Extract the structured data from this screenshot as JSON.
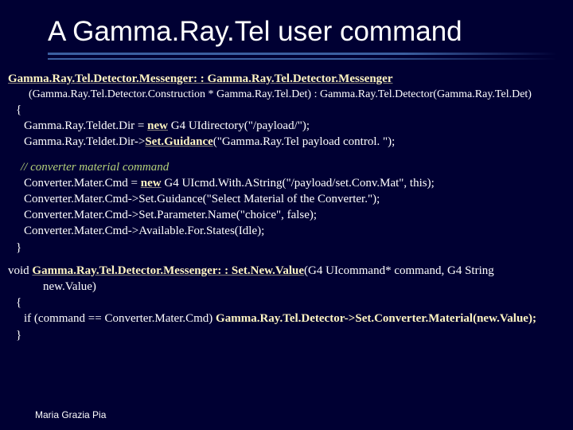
{
  "title": "A Gamma.Ray.Tel user command",
  "ctor_decl": "Gamma.Ray.Tel.Detector.Messenger: : Gamma.Ray.Tel.Detector.Messenger",
  "ctor_params": "(Gamma.Ray.Tel.Detector.Construction * Gamma.Ray.Tel.Det) : Gamma.Ray.Tel.Detector(Gamma.Ray.Tel.Det)",
  "open_brace": "{",
  "line_dir1_pre": "Gamma.Ray.Teldet.Dir = ",
  "line_dir1_bold": "new",
  "line_dir1_post": " G4 UIdirectory(\"/payload/\");",
  "line_dir2_pre": "Gamma.Ray.Teldet.Dir->",
  "line_dir2_bold": "Set.Guidance",
  "line_dir2_post": "(\"Gamma.Ray.Tel payload control. \");",
  "comment_text": "// converter material command",
  "conv1_pre": "Converter.Mater.Cmd = ",
  "conv1_bold": "new",
  "conv1_post": " G4 UIcmd.With.AString(\"/payload/set.Conv.Mat\", this);",
  "conv2": "Converter.Mater.Cmd->Set.Guidance(\"Select Material of the Converter.\");",
  "conv3": "Converter.Mater.Cmd->Set.Parameter.Name(\"choice\", false);",
  "conv4": "Converter.Mater.Cmd->Available.For.States(Idle);",
  "close_brace": "}",
  "fn2_pre": "void ",
  "fn2_bold": "Gamma.Ray.Tel.Detector.Messenger: : Set.New.Value",
  "fn2_post": "(G4 UIcommand* command, G4 String",
  "fn2_cont": "new.Value)",
  "open_brace2": "{",
  "fn2_body_pre": "if (command == Converter.Mater.Cmd) ",
  "fn2_body_bold": "Gamma.Ray.Tel.Detector->Set.Converter.Material(new.Value);",
  "close_brace2": "}",
  "footer": "Maria Grazia Pia"
}
